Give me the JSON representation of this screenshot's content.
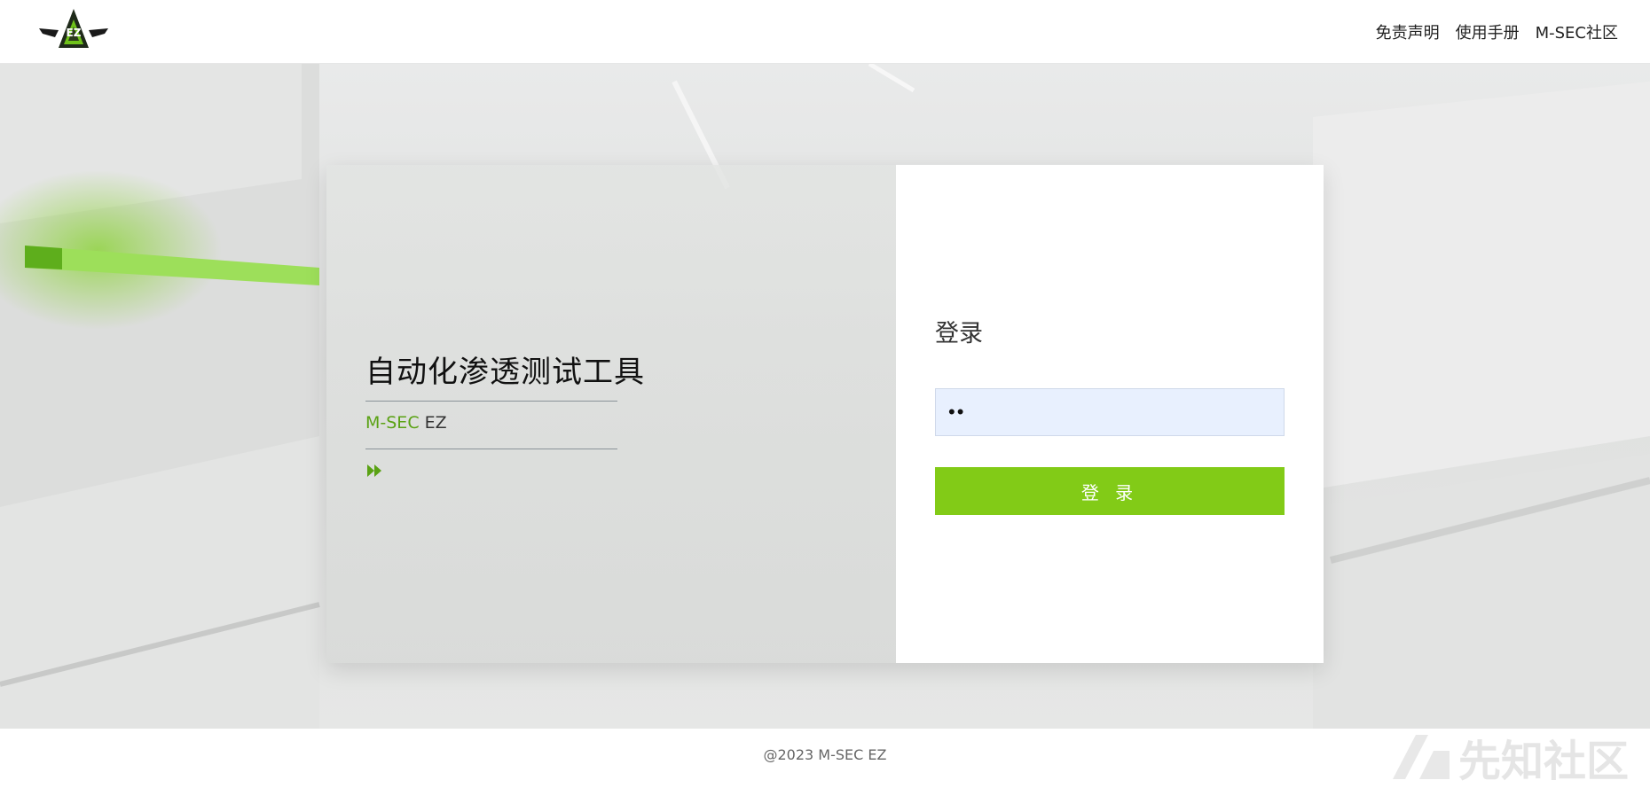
{
  "header": {
    "logo_text": "EZ",
    "nav": [
      "免责声明",
      "使用手册",
      "M-SEC社区"
    ]
  },
  "hero": {
    "title": "自动化渗透测试工具",
    "brand_green": "M-SEC",
    "brand_dark": "EZ",
    "more_icon": "fast-forward-icon"
  },
  "login": {
    "title": "登录",
    "password_value": "••",
    "button_label": "登 录"
  },
  "footer": {
    "copyright": "@2023 M-SEC EZ",
    "watermark": "先知社区"
  },
  "colors": {
    "accent": "#82cb17",
    "brand_green": "#5aa214",
    "input_bg": "#e8f0fe"
  }
}
